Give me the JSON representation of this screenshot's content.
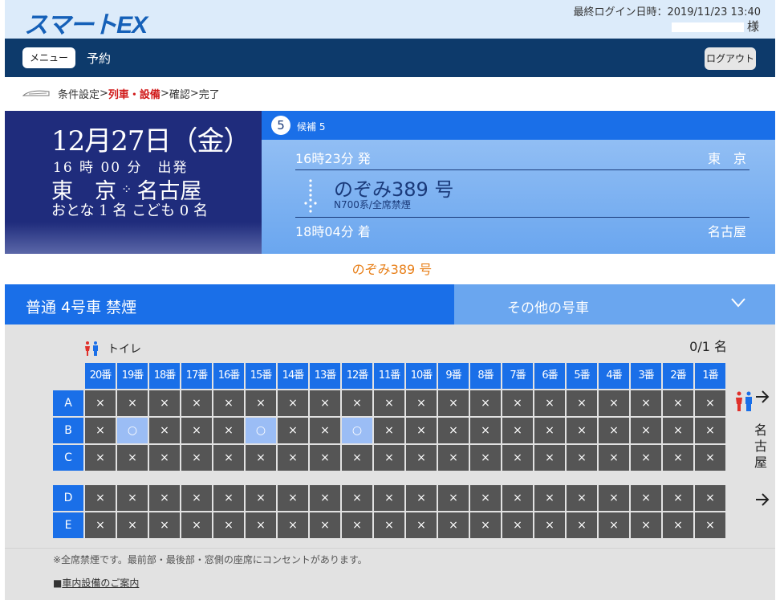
{
  "header": {
    "logo": "スマートEX",
    "last_login": "最終ログイン日時：2019/11/23 13:40",
    "user_suffix": "様"
  },
  "nav": {
    "menu_label": "メニュー",
    "reserve_label": "予約",
    "logout_label": "ログアウト"
  },
  "breadcrumb": {
    "step1": "条件設定",
    "sep": ">",
    "step2": "列車・設備",
    "step3": "確認",
    "step4": "完了"
  },
  "summary": {
    "date": "12月27日（金）",
    "time": "16 時 00 分　出発",
    "from": "東　京",
    "to": "名古屋",
    "passengers": "おとな 1 名 こども 0 名"
  },
  "candidate": {
    "number": "5",
    "label": "候補 5",
    "departure_time": "16時23分 発",
    "departure_station": "東　京",
    "train_name": "のぞみ389 号",
    "car_info": "N700系/全席禁煙",
    "arrival_time": "18時04分 着",
    "arrival_station": "名古屋"
  },
  "train_title": "のぞみ389 号",
  "car_bar": {
    "current": "普通 4号車 禁煙",
    "other": "その他の号車"
  },
  "seat_map": {
    "toilet_label": "トイレ",
    "count": "0/1 名",
    "destination": [
      "名",
      "古",
      "屋"
    ],
    "columns": [
      "20番",
      "19番",
      "18番",
      "17番",
      "16番",
      "15番",
      "14番",
      "13番",
      "12番",
      "11番",
      "10番",
      "9番",
      "8番",
      "7番",
      "6番",
      "5番",
      "4番",
      "3番",
      "2番",
      "1番"
    ],
    "rows": [
      {
        "label": "A",
        "seats": [
          "×",
          "×",
          "×",
          "×",
          "×",
          "×",
          "×",
          "×",
          "×",
          "×",
          "×",
          "×",
          "×",
          "×",
          "×",
          "×",
          "×",
          "×",
          "×",
          "×"
        ]
      },
      {
        "label": "B",
        "seats": [
          "×",
          "○",
          "×",
          "×",
          "×",
          "○",
          "×",
          "×",
          "○",
          "×",
          "×",
          "×",
          "×",
          "×",
          "×",
          "×",
          "×",
          "×",
          "×",
          "×"
        ]
      },
      {
        "label": "C",
        "seats": [
          "×",
          "×",
          "×",
          "×",
          "×",
          "×",
          "×",
          "×",
          "×",
          "×",
          "×",
          "×",
          "×",
          "×",
          "×",
          "×",
          "×",
          "×",
          "×",
          "×"
        ]
      },
      {
        "label": "D",
        "seats": [
          "×",
          "×",
          "×",
          "×",
          "×",
          "×",
          "×",
          "×",
          "×",
          "×",
          "×",
          "×",
          "×",
          "×",
          "×",
          "×",
          "×",
          "×",
          "×",
          "×"
        ]
      },
      {
        "label": "E",
        "seats": [
          "×",
          "×",
          "×",
          "×",
          "×",
          "×",
          "×",
          "×",
          "×",
          "×",
          "×",
          "×",
          "×",
          "×",
          "×",
          "×",
          "×",
          "×",
          "×",
          "×"
        ]
      }
    ]
  },
  "notes": {
    "text": "※全席禁煙です。最前部・最後部・窓側の座席にコンセントがあります。",
    "link_prefix": "■",
    "link_label": "車内設備のご案内"
  }
}
